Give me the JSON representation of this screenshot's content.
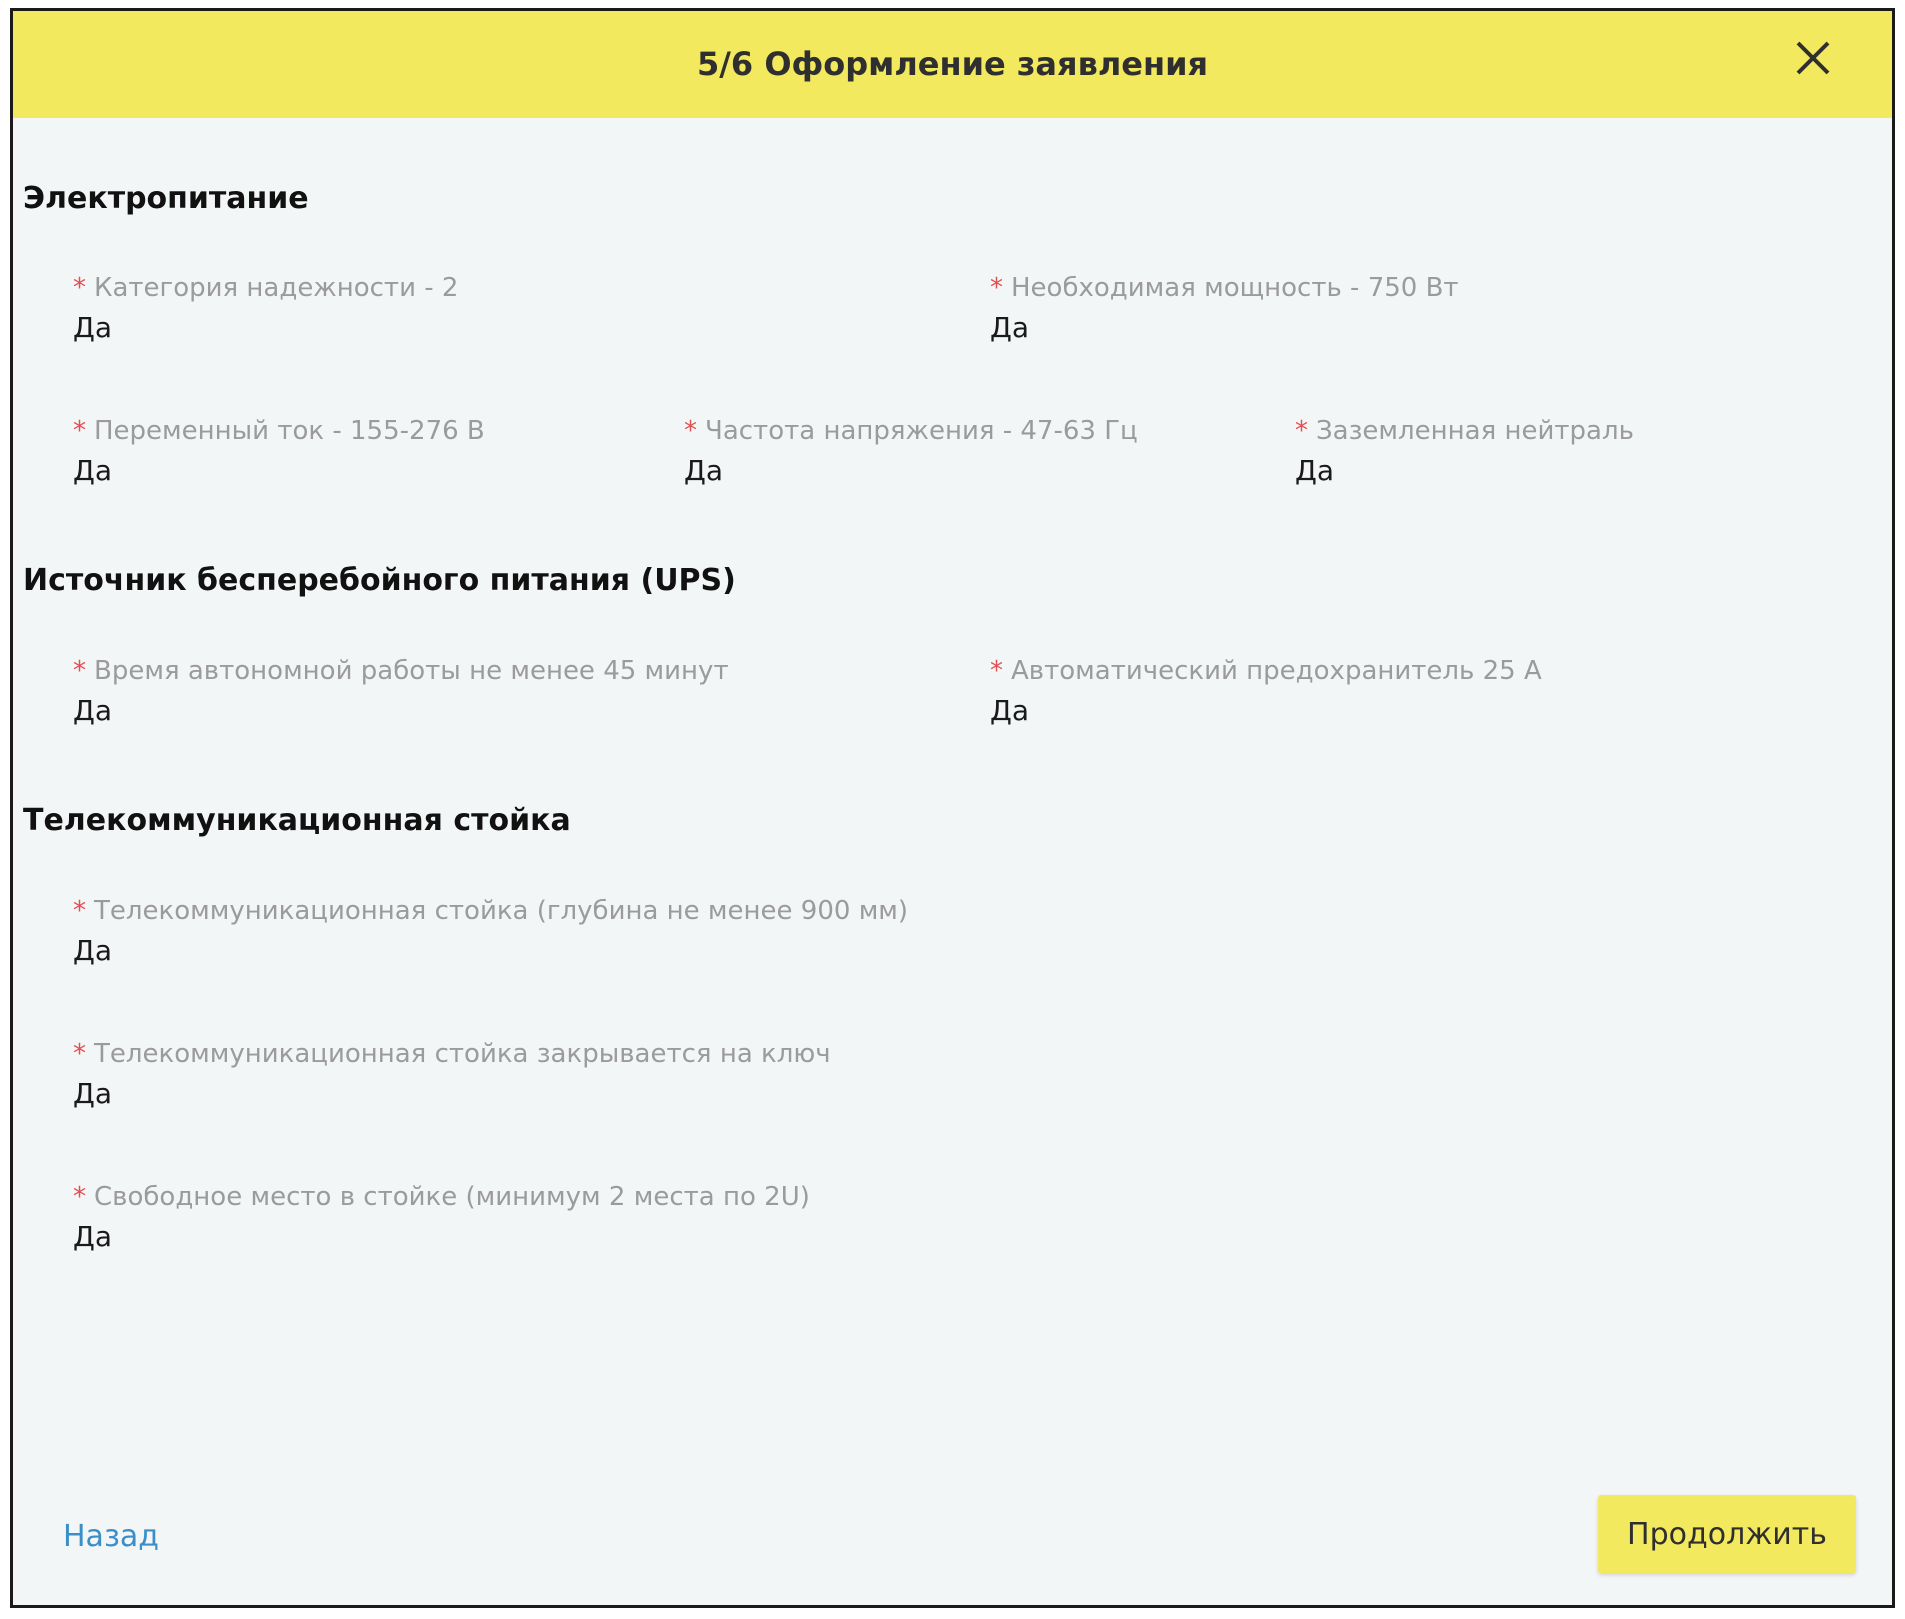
{
  "header": {
    "title": "5/6 Оформление заявления"
  },
  "sections": [
    {
      "title": "Электропитание",
      "fields": [
        {
          "label": "Категория надежности - 2",
          "value": "Да"
        },
        {
          "label": "Необходимая мощность - 750 Вт",
          "value": "Да"
        },
        {
          "label": "Переменный ток - 155-276 В",
          "value": "Да"
        },
        {
          "label": "Частота напряжения - 47-63 Гц",
          "value": "Да"
        },
        {
          "label": "Заземленная нейтраль",
          "value": "Да"
        }
      ]
    },
    {
      "title": "Источник бесперебойного питания (UPS)",
      "fields": [
        {
          "label": "Время автономной работы не менее 45 минут",
          "value": "Да"
        },
        {
          "label": "Автоматический предохранитель 25 А",
          "value": "Да"
        }
      ]
    },
    {
      "title": "Телекоммуникационная стойка",
      "fields": [
        {
          "label": "Телекоммуникационная стойка (глубина не менее 900 мм)",
          "value": "Да"
        },
        {
          "label": "Телекоммуникационная стойка закрывается на ключ",
          "value": "Да"
        },
        {
          "label": "Свободное место в стойке (минимум 2 места по 2U)",
          "value": "Да"
        }
      ]
    }
  ],
  "required_marker": "*",
  "footer": {
    "back_label": "Назад",
    "continue_label": "Продолжить"
  },
  "colors": {
    "accent": "#f3e95f",
    "link": "#3b8fc9",
    "required": "#e05050",
    "background": "#f3f6f7"
  },
  "icons": {
    "close": "close-icon"
  }
}
